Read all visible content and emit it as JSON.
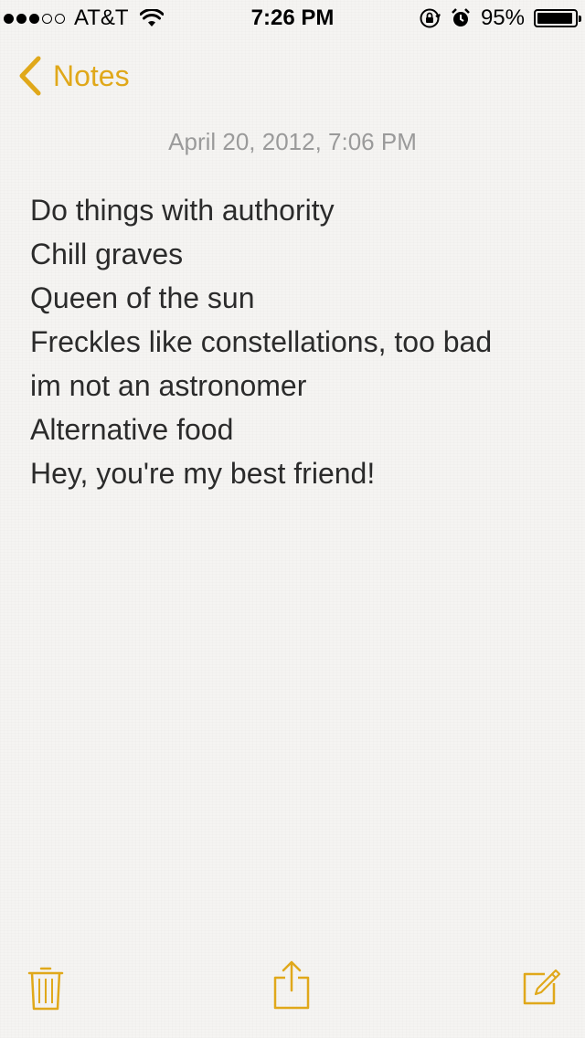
{
  "status_bar": {
    "carrier": "AT&T",
    "time": "7:26 PM",
    "battery_percent": "95%",
    "battery_level": 0.95,
    "signal_filled": 3,
    "signal_total": 5
  },
  "nav": {
    "back_label": "Notes"
  },
  "note": {
    "date": "April 20, 2012, 7:06 PM",
    "lines": [
      "Do things with authority",
      "Chill graves",
      "Queen of the sun",
      "Freckles like constellations, too bad",
      "im not an astronomer",
      "Alternative food",
      "Hey, you're my best friend!"
    ]
  },
  "toolbar": {
    "icons": [
      "trash-icon",
      "share-icon",
      "compose-icon"
    ]
  },
  "colors": {
    "accent": "#e0a81a",
    "date_text": "#9a9a9a",
    "body_text": "#2b2b2b",
    "background": "#f5f4f2"
  }
}
